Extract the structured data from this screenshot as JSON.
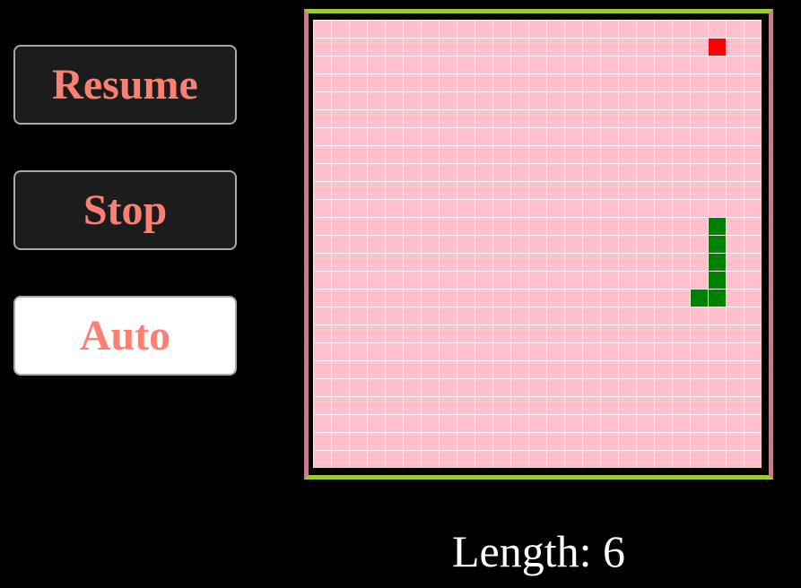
{
  "controls": {
    "resume_label": "Resume",
    "stop_label": "Stop",
    "auto_label": "Auto",
    "active": "auto"
  },
  "board": {
    "cols": 25,
    "rows": 25,
    "colors": {
      "background": "#ffc0cb",
      "grid_lines": "#ffffff",
      "snake": "#008000",
      "food": "#ff0000",
      "frame_top_bottom": "#9acd32",
      "frame_sides": "#db7093"
    },
    "food": {
      "col": 22,
      "row": 1
    },
    "snake": [
      {
        "col": 22,
        "row": 11
      },
      {
        "col": 22,
        "row": 12
      },
      {
        "col": 22,
        "row": 13
      },
      {
        "col": 22,
        "row": 14
      },
      {
        "col": 22,
        "row": 15
      },
      {
        "col": 21,
        "row": 15
      }
    ]
  },
  "status": {
    "length_text": "Length: 6"
  },
  "theme": {
    "button_text": "#fa8072",
    "button_bg": "#1c1c1c",
    "button_active_bg": "#ffffff",
    "page_bg": "#000000"
  }
}
